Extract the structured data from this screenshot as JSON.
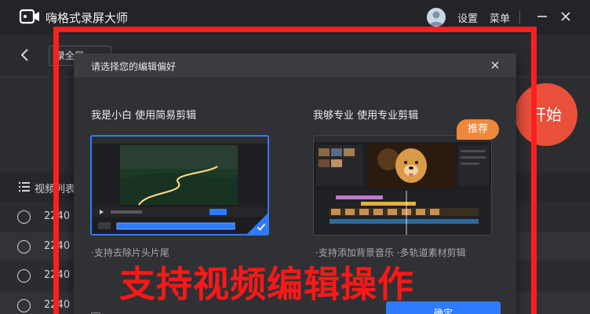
{
  "app": {
    "title": "嗨格式录屏大师",
    "settings_label": "设置",
    "menu_label": "菜单"
  },
  "toolbar": {
    "mode_value": "录全屏"
  },
  "main": {
    "start_label": "开始",
    "list_title": "视频列表",
    "rows": [
      "2240",
      "2240",
      "2240",
      "2240"
    ]
  },
  "dialog": {
    "title": "请选择您的编辑偏好",
    "simple": {
      "title": "我是小白 使用简易剪辑",
      "desc": "·支持去除片头片尾"
    },
    "pro": {
      "title": "我够专业 使用专业剪辑",
      "badge": "推荐",
      "desc": "·支持添加背景音乐 ·多轨道素材剪辑"
    },
    "confirm_label": "确定"
  },
  "annotation": {
    "caption": "支持视频编辑操作"
  },
  "colors": {
    "accent_blue": "#2f7bff",
    "start_red": "#e8503a",
    "badge_orange": "#f0883a",
    "annotation_red": "#ff1f1f"
  }
}
